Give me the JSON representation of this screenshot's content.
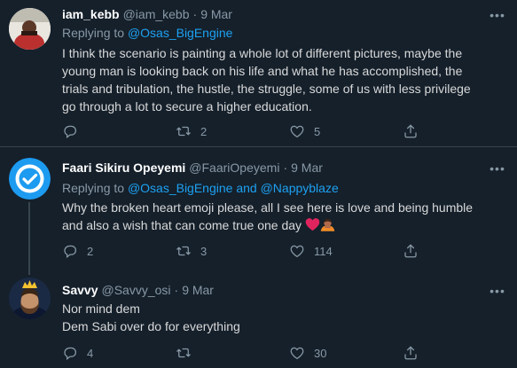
{
  "tweets": [
    {
      "display_name": "iam_kebb",
      "handle": "@iam_kebb",
      "separator": "·",
      "date": "9 Mar",
      "replying_prefix": "Replying to",
      "replying_to": "@Osas_BigEngine",
      "replying_and": "",
      "replying_to_2": "",
      "body_lines": [
        "I think the scenario is painting a whole lot of different pictures, maybe the",
        "young man is looking back on his life and what he has accomplished, the",
        "trials and tribulation, the hustle, the struggle, some of us with less privilege",
        "go through a lot to secure a higher education."
      ],
      "replies": "",
      "retweets": "2",
      "likes": "5"
    },
    {
      "display_name": "Faari Sikiru Opeyemi",
      "handle": "@FaariOpeyemi",
      "separator": "·",
      "date": "9 Mar",
      "replying_prefix": "Replying to",
      "replying_to": "@Osas_BigEngine",
      "replying_and": "and",
      "replying_to_2": "@Nappyblaze",
      "body_lines": [
        "Why the broken heart emoji please, all I see here is love and being humble",
        "and also a wish that can come true one day"
      ],
      "emoji": [
        "red-heart",
        "person-bowing"
      ],
      "replies": "2",
      "retweets": "3",
      "likes": "114"
    },
    {
      "display_name": "Savvy",
      "handle": "@Savvy_osi",
      "separator": "·",
      "date": "9 Mar",
      "body_lines": [
        "Nor mind dem",
        "Dem Sabi over do for everything"
      ],
      "replies": "4",
      "retweets": "",
      "likes": "30"
    }
  ],
  "icons": {
    "reply": "reply-icon",
    "retweet": "retweet-icon",
    "like": "like-icon",
    "share": "share-icon",
    "more": "more-icon"
  },
  "colors": {
    "background": "#15202b",
    "divider": "#38444d",
    "muted": "#8899a6",
    "accent": "#1da1f2",
    "text": "#d9d9d9",
    "heart": "#e0245e"
  }
}
